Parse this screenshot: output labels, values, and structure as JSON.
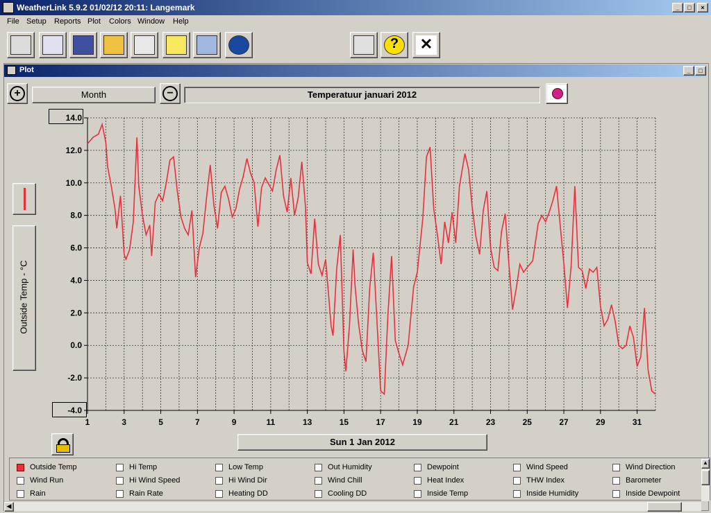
{
  "window": {
    "title": "WeatherLink 5.9.2  01/02/12  20:11: Langemark"
  },
  "menu": [
    "File",
    "Setup",
    "Reports",
    "Plot",
    "Colors",
    "Window",
    "Help"
  ],
  "toolbar": {
    "icons": [
      "station-icon",
      "download-icon",
      "bulletin-icon",
      "strip-chart-icon",
      "plot-icon",
      "notes-icon",
      "weather-icon",
      "noaa-icon",
      "print-icon",
      "help-icon",
      "close-icon"
    ]
  },
  "plot": {
    "child_title": "Plot",
    "period_label": "Month",
    "chart_title": "Temperatuur  januari 2012",
    "y_axis_label": "Outside Temp - °C",
    "date_label": "Sun 1 Jan 2012",
    "line_color": "#e8303c"
  },
  "chart_data": {
    "type": "line",
    "title": "Temperatuur  januari 2012",
    "ylabel": "Outside Temp - °C",
    "xlabel": "",
    "ylim": [
      -4,
      14
    ],
    "xlim": [
      1,
      32
    ],
    "grid": true,
    "y_ticks": [
      "14.0",
      "12.0",
      "10.0",
      "8.0",
      "6.0",
      "4.0",
      "2.0",
      "0.0",
      "-2.0",
      "-4.0"
    ],
    "x_ticks": [
      "1",
      "3",
      "5",
      "7",
      "9",
      "11",
      "13",
      "15",
      "17",
      "19",
      "21",
      "23",
      "25",
      "27",
      "29",
      "31"
    ],
    "series": [
      {
        "values": [
          [
            1.0,
            12.4
          ],
          [
            1.3,
            12.8
          ],
          [
            1.6,
            13.0
          ],
          [
            1.8,
            13.6
          ],
          [
            2.0,
            12.5
          ],
          [
            2.1,
            11.0
          ],
          [
            2.3,
            9.8
          ],
          [
            2.5,
            8.4
          ],
          [
            2.6,
            7.2
          ],
          [
            2.8,
            9.2
          ],
          [
            3.0,
            5.6
          ],
          [
            3.1,
            5.3
          ],
          [
            3.3,
            5.9
          ],
          [
            3.5,
            7.6
          ],
          [
            3.7,
            12.8
          ],
          [
            3.8,
            9.8
          ],
          [
            4.0,
            8.0
          ],
          [
            4.2,
            6.8
          ],
          [
            4.4,
            7.4
          ],
          [
            4.5,
            5.5
          ],
          [
            4.7,
            8.8
          ],
          [
            4.9,
            9.3
          ],
          [
            5.1,
            8.9
          ],
          [
            5.3,
            10.0
          ],
          [
            5.5,
            11.4
          ],
          [
            5.7,
            11.6
          ],
          [
            5.9,
            9.5
          ],
          [
            6.1,
            7.9
          ],
          [
            6.3,
            7.2
          ],
          [
            6.5,
            6.8
          ],
          [
            6.7,
            8.3
          ],
          [
            6.9,
            4.2
          ],
          [
            7.1,
            6.0
          ],
          [
            7.3,
            6.9
          ],
          [
            7.5,
            9.1
          ],
          [
            7.7,
            11.1
          ],
          [
            7.9,
            8.6
          ],
          [
            8.1,
            7.2
          ],
          [
            8.3,
            9.4
          ],
          [
            8.5,
            9.8
          ],
          [
            8.7,
            9.0
          ],
          [
            8.9,
            7.9
          ],
          [
            9.1,
            8.4
          ],
          [
            9.3,
            9.6
          ],
          [
            9.5,
            10.4
          ],
          [
            9.7,
            11.5
          ],
          [
            9.9,
            10.6
          ],
          [
            10.1,
            10.0
          ],
          [
            10.3,
            7.3
          ],
          [
            10.5,
            9.7
          ],
          [
            10.7,
            10.3
          ],
          [
            10.9,
            9.9
          ],
          [
            11.1,
            9.5
          ],
          [
            11.3,
            10.8
          ],
          [
            11.5,
            11.7
          ],
          [
            11.7,
            9.2
          ],
          [
            11.9,
            8.2
          ],
          [
            12.1,
            10.3
          ],
          [
            12.3,
            8.0
          ],
          [
            12.5,
            9.1
          ],
          [
            12.7,
            11.3
          ],
          [
            12.9,
            8.5
          ],
          [
            13.0,
            5.1
          ],
          [
            13.2,
            4.4
          ],
          [
            13.4,
            7.8
          ],
          [
            13.6,
            5.0
          ],
          [
            13.8,
            4.3
          ],
          [
            14.0,
            5.3
          ],
          [
            14.3,
            1.2
          ],
          [
            14.4,
            0.6
          ],
          [
            14.6,
            4.7
          ],
          [
            14.8,
            6.8
          ],
          [
            15.0,
            -0.4
          ],
          [
            15.1,
            -1.6
          ],
          [
            15.3,
            1.2
          ],
          [
            15.5,
            5.9
          ],
          [
            15.6,
            3.7
          ],
          [
            15.8,
            1.3
          ],
          [
            16.0,
            -0.3
          ],
          [
            16.2,
            -1.0
          ],
          [
            16.4,
            3.5
          ],
          [
            16.6,
            5.7
          ],
          [
            16.8,
            1.5
          ],
          [
            17.0,
            -2.8
          ],
          [
            17.2,
            -3.0
          ],
          [
            17.4,
            1.9
          ],
          [
            17.6,
            5.5
          ],
          [
            17.8,
            0.3
          ],
          [
            18.0,
            -0.5
          ],
          [
            18.2,
            -1.2
          ],
          [
            18.5,
            0.0
          ],
          [
            18.8,
            3.6
          ],
          [
            19.0,
            4.5
          ],
          [
            19.3,
            7.8
          ],
          [
            19.5,
            11.6
          ],
          [
            19.7,
            12.2
          ],
          [
            19.9,
            8.4
          ],
          [
            20.1,
            6.8
          ],
          [
            20.3,
            5.0
          ],
          [
            20.5,
            7.6
          ],
          [
            20.7,
            6.3
          ],
          [
            20.9,
            8.2
          ],
          [
            21.1,
            6.3
          ],
          [
            21.3,
            9.8
          ],
          [
            21.6,
            11.8
          ],
          [
            21.8,
            10.8
          ],
          [
            22.0,
            8.5
          ],
          [
            22.2,
            6.7
          ],
          [
            22.4,
            5.6
          ],
          [
            22.6,
            8.3
          ],
          [
            22.8,
            9.5
          ],
          [
            23.0,
            6.0
          ],
          [
            23.2,
            4.8
          ],
          [
            23.4,
            4.6
          ],
          [
            23.6,
            7.0
          ],
          [
            23.8,
            8.1
          ],
          [
            24.0,
            5.0
          ],
          [
            24.2,
            2.2
          ],
          [
            24.4,
            3.5
          ],
          [
            24.6,
            5.0
          ],
          [
            24.8,
            4.5
          ],
          [
            25.0,
            4.8
          ],
          [
            25.3,
            5.2
          ],
          [
            25.6,
            7.5
          ],
          [
            25.8,
            8.0
          ],
          [
            26.0,
            7.6
          ],
          [
            26.2,
            8.2
          ],
          [
            26.4,
            8.9
          ],
          [
            26.6,
            9.8
          ],
          [
            26.8,
            7.4
          ],
          [
            27.0,
            5.0
          ],
          [
            27.2,
            2.3
          ],
          [
            27.4,
            4.9
          ],
          [
            27.6,
            9.8
          ],
          [
            27.8,
            4.8
          ],
          [
            28.0,
            4.6
          ],
          [
            28.2,
            3.5
          ],
          [
            28.4,
            4.7
          ],
          [
            28.6,
            4.5
          ],
          [
            28.8,
            4.8
          ],
          [
            29.0,
            2.4
          ],
          [
            29.2,
            1.2
          ],
          [
            29.4,
            1.6
          ],
          [
            29.6,
            2.5
          ],
          [
            29.8,
            1.5
          ],
          [
            30.0,
            0.0
          ],
          [
            30.2,
            -0.2
          ],
          [
            30.4,
            0.0
          ],
          [
            30.6,
            1.2
          ],
          [
            30.8,
            0.5
          ],
          [
            31.0,
            -1.3
          ],
          [
            31.2,
            -0.7
          ],
          [
            31.4,
            2.3
          ],
          [
            31.6,
            -1.5
          ],
          [
            31.8,
            -2.8
          ],
          [
            32.0,
            -3.0
          ]
        ]
      }
    ]
  },
  "legend": [
    [
      "Outside Temp",
      "Hi Temp",
      "Low Temp",
      "Out Humidity",
      "Dewpoint",
      "Wind Speed",
      "Wind Direction"
    ],
    [
      "Wind Run",
      "Hi Wind Speed",
      "Hi Wind Dir",
      "Wind Chill",
      "Heat Index",
      "THW Index",
      "Barometer"
    ],
    [
      "Rain",
      "Rain Rate",
      "Heating DD",
      "Cooling DD",
      "Inside Temp",
      "Inside Humidity",
      "Inside Dewpoint"
    ]
  ],
  "legend_checked": "Outside Temp"
}
